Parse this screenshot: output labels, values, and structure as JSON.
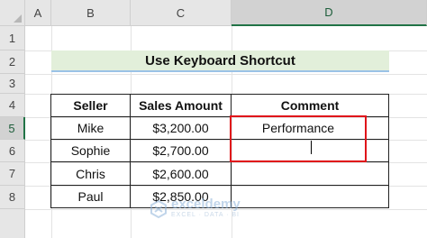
{
  "columns": [
    "A",
    "B",
    "C",
    "D"
  ],
  "rows": [
    "1",
    "2",
    "3",
    "4",
    "5",
    "6",
    "7",
    "8"
  ],
  "title": "Use Keyboard Shortcut",
  "table": {
    "headers": [
      "Seller",
      "Sales Amount",
      "Comment"
    ],
    "rows": [
      {
        "seller": "Mike",
        "amount": "$3,200.00",
        "comment": "Performance"
      },
      {
        "seller": "Sophie",
        "amount": "$2,700.00",
        "comment": ""
      },
      {
        "seller": "Chris",
        "amount": "$2,600.00",
        "comment": ""
      },
      {
        "seller": "Paul",
        "amount": "$2,850.00",
        "comment": ""
      }
    ]
  },
  "selection": {
    "column": "D",
    "row": "5"
  },
  "watermark": {
    "brand": "exceldemy",
    "tagline": "EXCEL · DATA · BI"
  },
  "colors": {
    "accent": "#217346",
    "active_border": "#e0141a",
    "title_fill": "#e2efda",
    "title_underline": "#9bc2e6"
  }
}
